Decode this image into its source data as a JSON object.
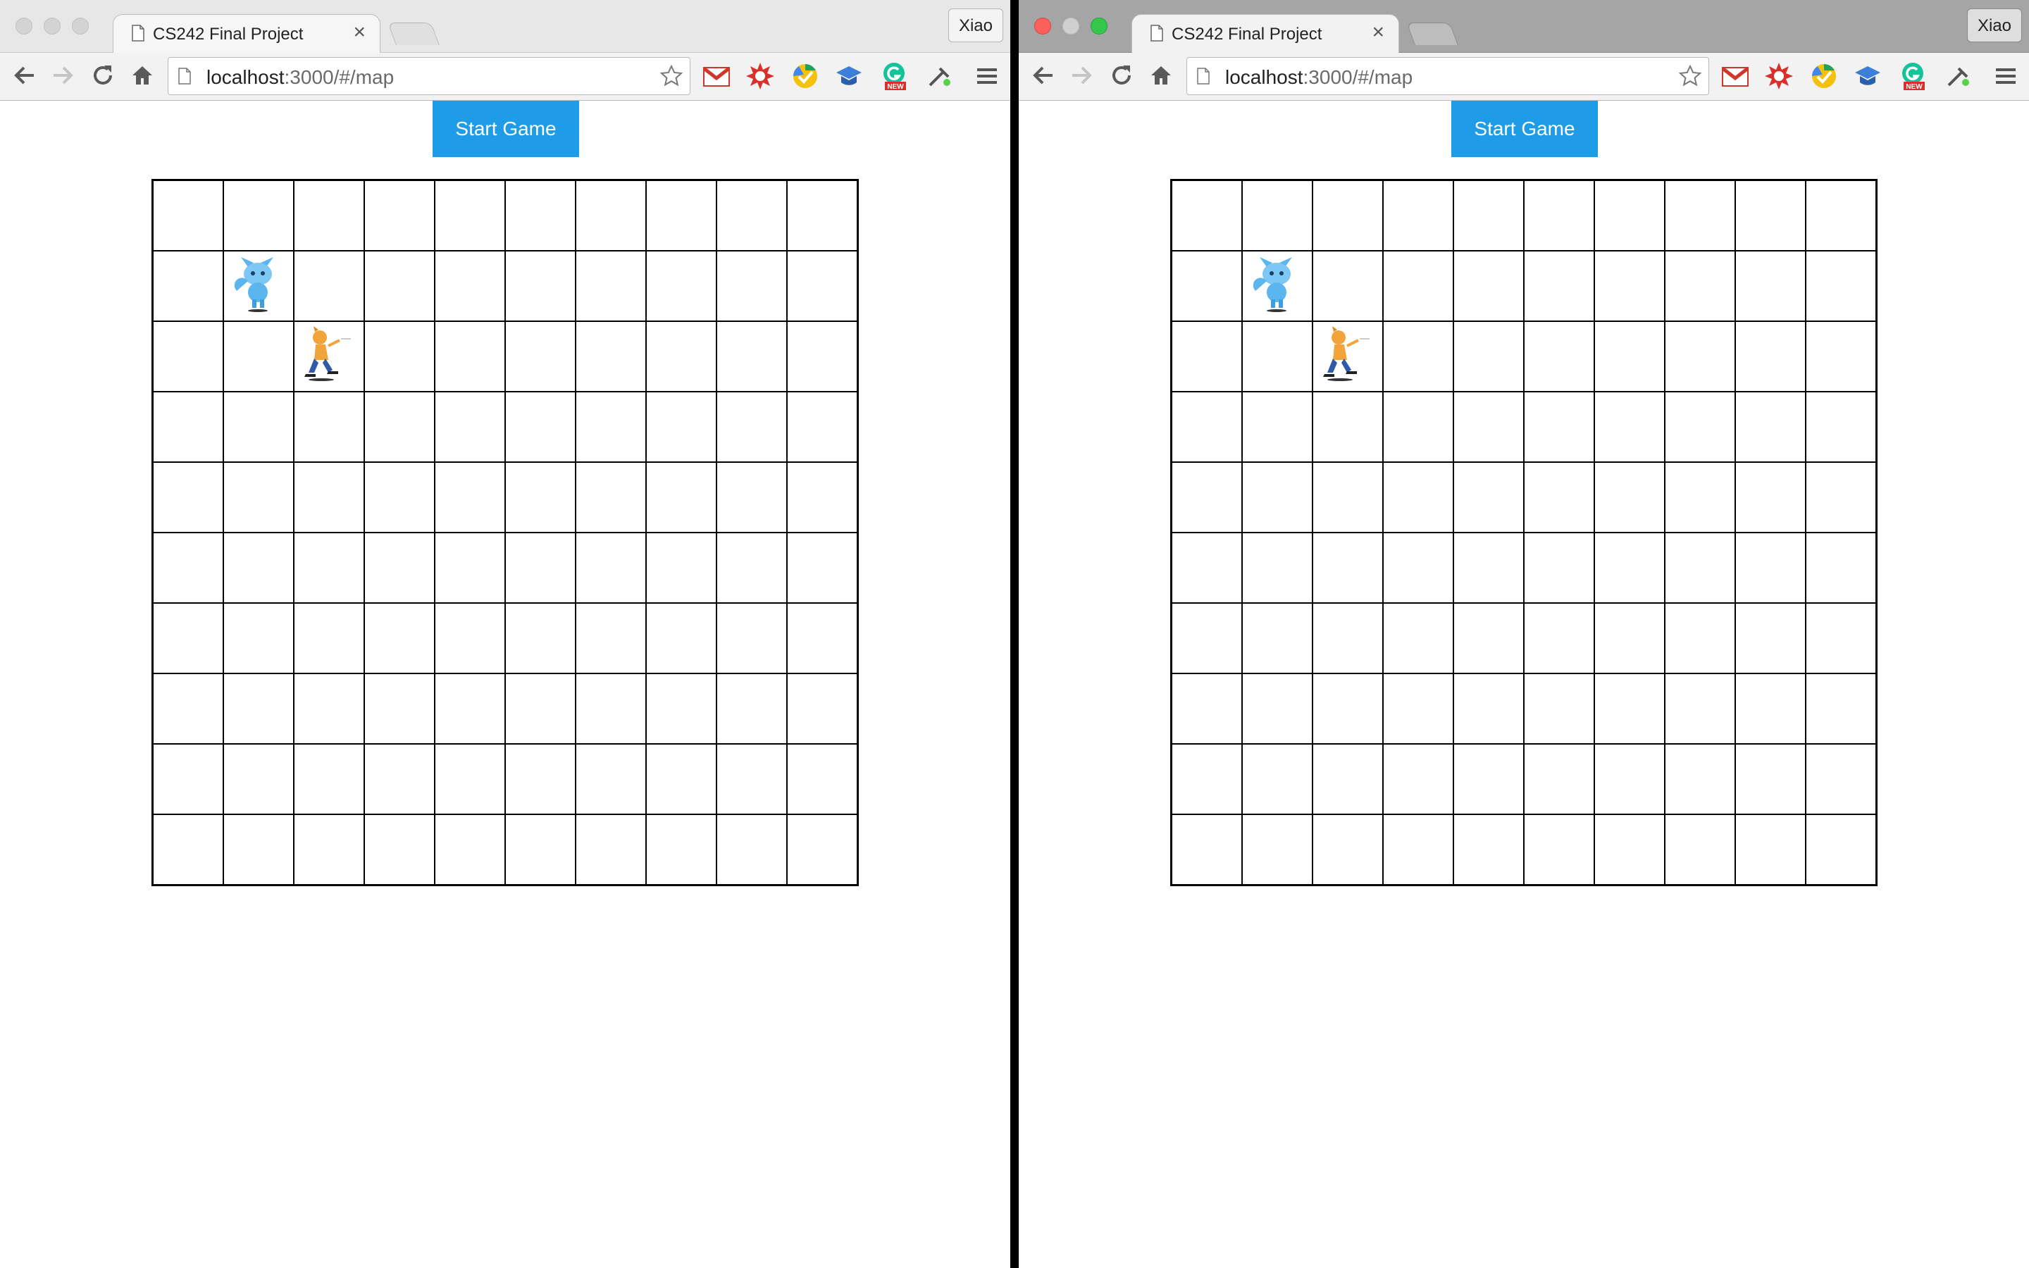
{
  "windows": [
    {
      "id": "left",
      "active": false,
      "tab": {
        "title": "CS242 Final Project",
        "close": "×"
      },
      "profile": "Xiao",
      "url": {
        "host": "localhost",
        "rest": ":3000/#/map"
      },
      "start_button": "Start Game",
      "grid": {
        "rows": 10,
        "cols": 10
      },
      "pieces": [
        {
          "name": "blue-fox-piece",
          "row": 2,
          "col": 2
        },
        {
          "name": "orange-cat-piece",
          "row": 3,
          "col": 3
        }
      ]
    },
    {
      "id": "right",
      "active": true,
      "tab": {
        "title": "CS242 Final Project",
        "close": "×"
      },
      "profile": "Xiao",
      "url": {
        "host": "localhost",
        "rest": ":3000/#/map"
      },
      "start_button": "Start Game",
      "grid": {
        "rows": 10,
        "cols": 10
      },
      "pieces": [
        {
          "name": "blue-fox-piece",
          "row": 2,
          "col": 2
        },
        {
          "name": "orange-cat-piece",
          "row": 3,
          "col": 3
        }
      ]
    }
  ],
  "extensions": [
    "gmail-icon",
    "burst-icon",
    "drive-check-icon",
    "graduation-cap-icon",
    "grammarly-new-icon",
    "color-picker-icon",
    "menu-icon"
  ],
  "grammarly_badge": "NEW",
  "colors": {
    "button": "#1f9ce8",
    "grid": "#000000"
  }
}
